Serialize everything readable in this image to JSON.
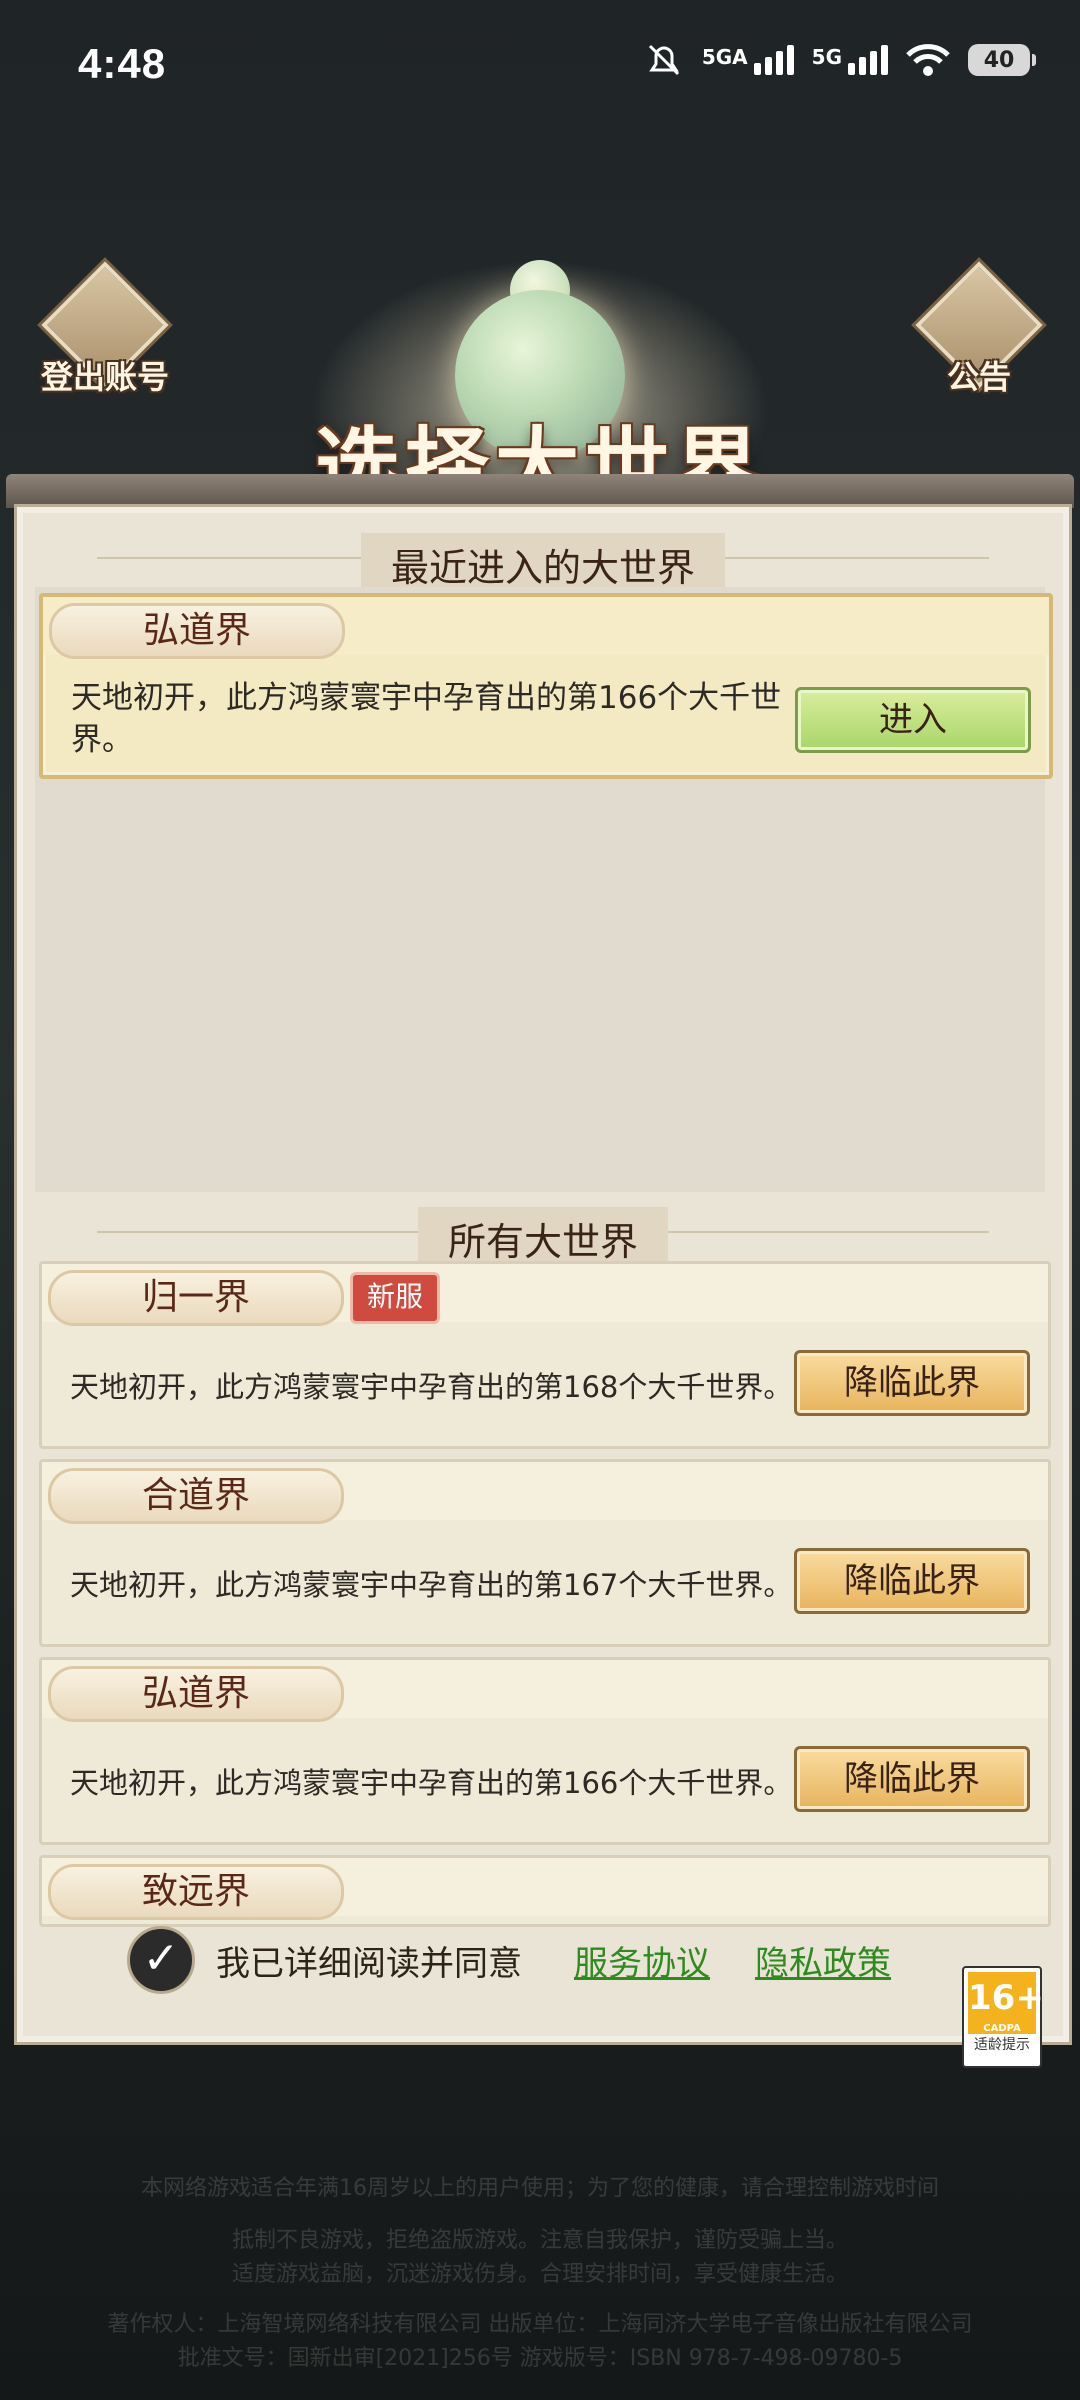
{
  "status_bar": {
    "time": "4:48",
    "sim1": "5GA",
    "sim2": "5G",
    "battery": "40"
  },
  "header": {
    "title": "选择大世界",
    "logout_label": "登出账号",
    "notice_label": "公告"
  },
  "recent": {
    "section_title": "最近进入的大世界",
    "worlds": [
      {
        "name": "弘道界",
        "desc": "天地初开，此方鸿蒙寰宇中孕育出的第166个大千世界。",
        "button": "进入"
      }
    ]
  },
  "all_worlds": {
    "section_title": "所有大世界",
    "worlds": [
      {
        "name": "归一界",
        "badge": "新服",
        "desc": "天地初开，此方鸿蒙寰宇中孕育出的第168个大千世界。",
        "button": "降临此界"
      },
      {
        "name": "合道界",
        "desc": "天地初开，此方鸿蒙寰宇中孕育出的第167个大千世界。",
        "button": "降临此界"
      },
      {
        "name": "弘道界",
        "desc": "天地初开，此方鸿蒙寰宇中孕育出的第166个大千世界。",
        "button": "降临此界"
      },
      {
        "name": "致远界"
      }
    ]
  },
  "agreement": {
    "text": "我已详细阅读并同意",
    "service_link": "服务协议",
    "privacy_link": "隐私政策",
    "checked": true
  },
  "age_rating": {
    "value": "16+",
    "org": "CADPA",
    "label": "适龄提示"
  },
  "footer": {
    "line1": "本网络游戏适合年满16周岁以上的用户使用；为了您的健康，请合理控制游戏时间",
    "line2": "抵制不良游戏，拒绝盗版游戏。注意自我保护，谨防受骗上当。",
    "line3": "适度游戏益脑，沉迷游戏伤身。合理安排时间，享受健康生活。",
    "line4": "著作权人：上海智境网络科技有限公司      出版单位：上海同济大学电子音像出版社有限公司",
    "line5": "批准文号：国新出审[2021]256号      游戏版号：ISBN 978-7-498-09780-5"
  }
}
